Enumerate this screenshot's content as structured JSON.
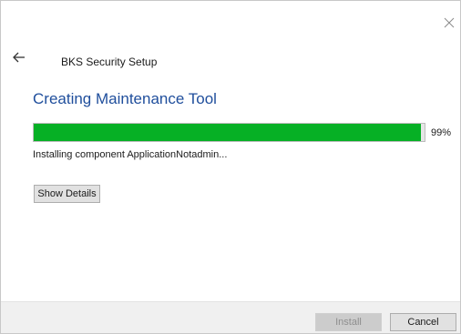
{
  "window": {
    "title": "BKS Security Setup",
    "close_icon": "close-icon",
    "back_icon": "back-arrow-icon"
  },
  "page": {
    "title": "Creating Maintenance Tool"
  },
  "progress": {
    "value": 0.99,
    "percent_label": "99%",
    "status": "Installing component ApplicationNotadmin...",
    "fill_color": "#06b025"
  },
  "buttons": {
    "show_details": "Show Details",
    "install": "Install",
    "cancel": "Cancel"
  },
  "colors": {
    "title_accent": "#1f4e9c",
    "progress_green": "#06b025",
    "footer_bg": "#f0f0f0"
  }
}
